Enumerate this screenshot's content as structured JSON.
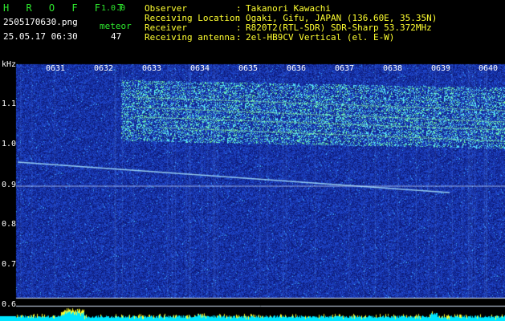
{
  "app": {
    "name": "H R O F F T",
    "version": "1.0.0"
  },
  "file": {
    "name": "2505170630.png",
    "datetime": "25.05.17 06:30"
  },
  "counter": {
    "label": "meteor",
    "value": "47"
  },
  "info": [
    {
      "key": "Observer",
      "sep": ":",
      "value": "Takanori Kawachi"
    },
    {
      "key": "Receiving Location",
      "sep": ":",
      "value": "Ogaki, Gifu, JAPAN (136.60E, 35.35N)"
    },
    {
      "key": "Receiver",
      "sep": ":",
      "value": "R820T2(RTL-SDR) SDR-Sharp 53.372MHz"
    },
    {
      "key": "Receiving antenna",
      "sep": ":",
      "value": "2el-HB9CV Vertical (el. E-W)"
    }
  ],
  "axis": {
    "unit": "kHz",
    "time_ticks": [
      "0631",
      "0632",
      "0633",
      "0634",
      "0635",
      "0636",
      "0637",
      "0638",
      "0639",
      "0640"
    ],
    "freq_ticks": [
      "1.1",
      "1.0",
      "0.9",
      "0.8",
      "0.7",
      "0.6"
    ]
  },
  "colors": {
    "header_green": "#2ee82e",
    "header_yellow": "#ffff30",
    "bg_blue": "#0a1a8c",
    "signal": "#7dffb0",
    "bar": "#00e5ff"
  }
}
